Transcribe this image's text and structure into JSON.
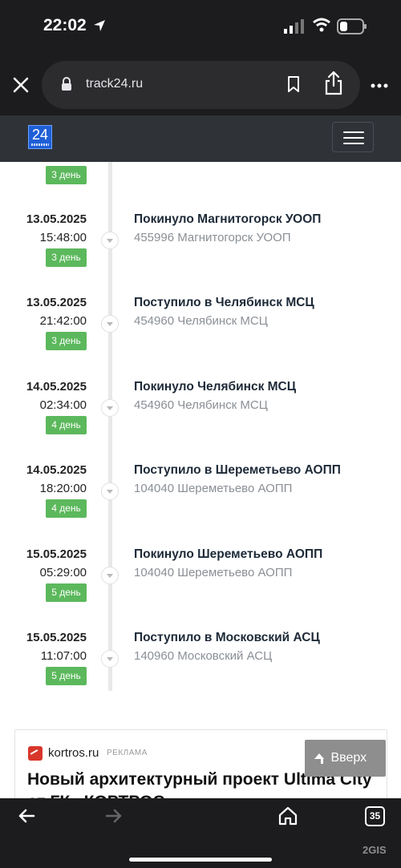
{
  "status_bar": {
    "time": "22:02"
  },
  "browser": {
    "url": "track24.ru"
  },
  "site": {
    "logo_text": "24"
  },
  "timeline": {
    "top_badge": "3 день",
    "events": [
      {
        "date": "13.05.2025",
        "time": "15:48:00",
        "badge": "3 день",
        "title": "Покинуло Магнитогорск УООП",
        "subtitle": "455996 Магнитогорск УООП"
      },
      {
        "date": "13.05.2025",
        "time": "21:42:00",
        "badge": "3 день",
        "title": "Поступило в Челябинск МСЦ",
        "subtitle": "454960 Челябинск МСЦ"
      },
      {
        "date": "14.05.2025",
        "time": "02:34:00",
        "badge": "4 день",
        "title": "Покинуло Челябинск МСЦ",
        "subtitle": "454960 Челябинск МСЦ"
      },
      {
        "date": "14.05.2025",
        "time": "18:20:00",
        "badge": "4 день",
        "title": "Поступило в Шереметьево АОПП",
        "subtitle": "104040 Шереметьево АОПП"
      },
      {
        "date": "15.05.2025",
        "time": "05:29:00",
        "badge": "5 день",
        "title": "Покинуло Шереметьево АОПП",
        "subtitle": "104040 Шереметьево АОПП"
      },
      {
        "date": "15.05.2025",
        "time": "11:07:00",
        "badge": "5 день",
        "title": "Поступило в Московский АСЦ",
        "subtitle": "140960 Московский АСЦ"
      }
    ]
  },
  "ad": {
    "site": "kortros.ru",
    "tag": "РЕКЛАМА",
    "title": "Новый архитектурный проект Ultima City от ГК «КОРТРОС»"
  },
  "up_button": {
    "label": "Вверх"
  },
  "toolbar": {
    "tabs_count": "35"
  },
  "watermark": "2GIS",
  "colors": {
    "badge_green": "#5cb85c",
    "header_bg": "#2f3338",
    "browser_bg": "#1c1c1e"
  }
}
